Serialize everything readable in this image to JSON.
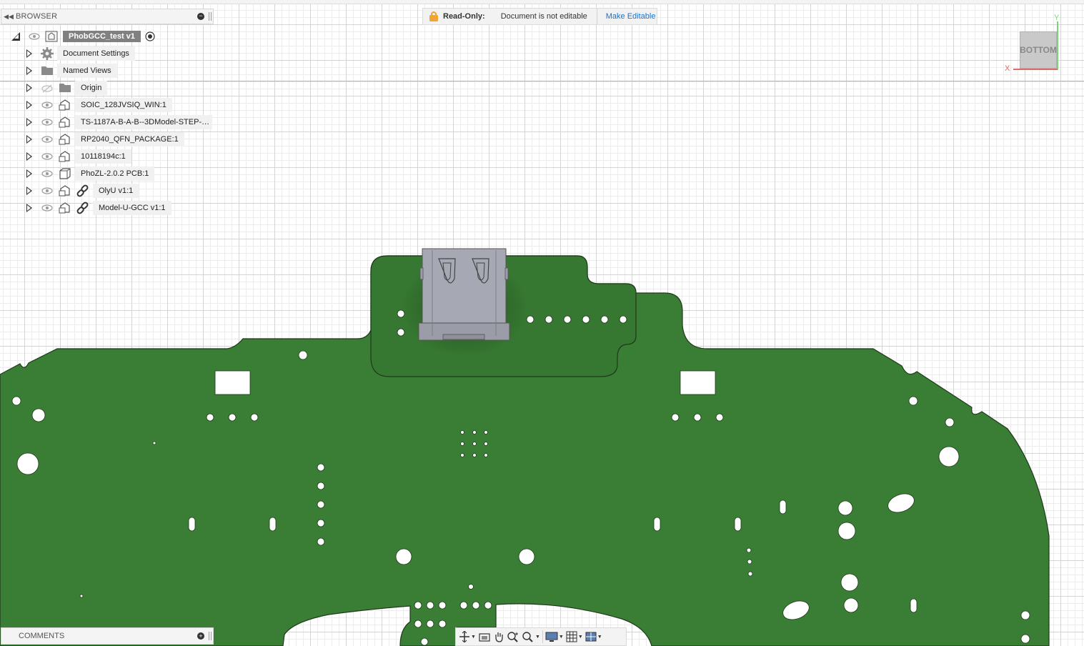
{
  "browser": {
    "title": "BROWSER",
    "root_label": "PhobGCC_test v1",
    "items": [
      {
        "label": "Document Settings",
        "icon": "gear-icon"
      },
      {
        "label": "Named Views",
        "icon": "folder-icon"
      },
      {
        "label": "Origin",
        "icon": "folder-icon"
      },
      {
        "label": "SOIC_128JVSIQ_WIN:1",
        "icon": "component-icon"
      },
      {
        "label": "TS-1187A-B-A-B--3DModel-STEP-…",
        "icon": "component-icon"
      },
      {
        "label": "RP2040_QFN_PACKAGE:1",
        "icon": "component-icon"
      },
      {
        "label": "10118194c:1",
        "icon": "component-icon"
      },
      {
        "label": "PhoZL-2.0.2 PCB:1",
        "icon": "body-icon"
      },
      {
        "label": "OlyU v1:1",
        "icon": "linked-component-icon"
      },
      {
        "label": "Model-U-GCC v1:1",
        "icon": "linked-component-icon"
      }
    ]
  },
  "readonly": {
    "title": "Read-Only:",
    "message": "Document is not editable",
    "action": "Make Editable"
  },
  "viewcube": {
    "face": "BOTTOM",
    "x_label": "X",
    "y_label": "Y"
  },
  "comments": {
    "title": "COMMENTS"
  },
  "nav_toolbar": {
    "tools": [
      "orbit-icon",
      "look-at-icon",
      "pan-icon",
      "zoom-icon",
      "fit-icon",
      "display-settings-icon",
      "grid-icon",
      "viewports-icon"
    ]
  },
  "colors": {
    "pcb": "#3a7d34",
    "usb_connector": "#a6a8b3",
    "x_axis": "#e06b6b",
    "y_axis": "#7bd67b",
    "link": "#1a73c8"
  }
}
